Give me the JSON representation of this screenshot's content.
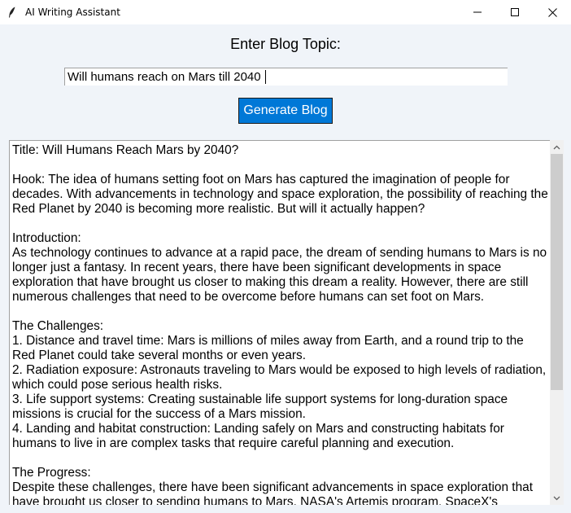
{
  "window": {
    "title": "AI Writing Assistant",
    "icon": "feather-icon"
  },
  "heading": "Enter Blog Topic:",
  "topic_input": {
    "value": "Will humans reach on Mars till 2040"
  },
  "generate_button": {
    "label": "Generate Blog",
    "color": "#0078d7"
  },
  "output": {
    "text": "Title: Will Humans Reach Mars by 2040?\n\nHook: The idea of humans setting foot on Mars has captured the imagination of people for decades. With advancements in technology and space exploration, the possibility of reaching the Red Planet by 2040 is becoming more realistic. But will it actually happen?\n\nIntroduction:\nAs technology continues to advance at a rapid pace, the dream of sending humans to Mars is no longer just a fantasy. In recent years, there have been significant developments in space exploration that have brought us closer to making this dream a reality. However, there are still numerous challenges that need to be overcome before humans can set foot on Mars.\n\nThe Challenges:\n1. Distance and travel time: Mars is millions of miles away from Earth, and a round trip to the Red Planet could take several months or even years.\n2. Radiation exposure: Astronauts traveling to Mars would be exposed to high levels of radiation, which could pose serious health risks.\n3. Life support systems: Creating sustainable life support systems for long-duration space missions is crucial for the success of a Mars mission.\n4. Landing and habitat construction: Landing safely on Mars and constructing habitats for humans to live in are complex tasks that require careful planning and execution.\n\nThe Progress:\nDespite these challenges, there have been significant advancements in space exploration that have brought us closer to sending humans to Mars. NASA's Artemis program, SpaceX's"
  }
}
